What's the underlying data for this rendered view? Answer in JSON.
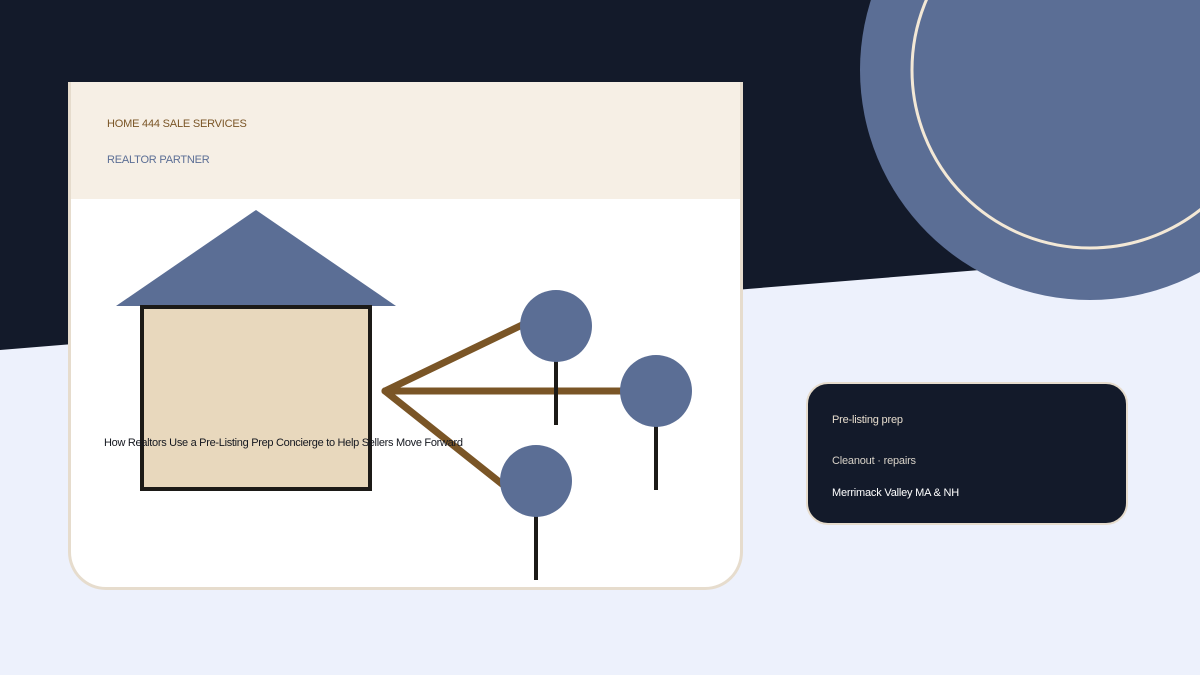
{
  "brand": {
    "eyebrow": "HOME 444 SALE SERVICES",
    "subtag": "REALTOR PARTNER"
  },
  "hero": {
    "headline": "How Realtors Use a Pre-Listing Prep Concierge to Help Sellers Move Forward"
  },
  "info_card": {
    "line1": "Pre-listing prep",
    "line2": "Cleanout · repairs",
    "line3": "Merrimack Valley MA & NH"
  },
  "illustration": {
    "house_icon": "house-icon",
    "tree_icon": "tree-icon",
    "branch_icon": "branch-line-icon"
  },
  "colors": {
    "navy": "#131a2a",
    "slate_blue": "#5b6e95",
    "cream": "#f6efe5",
    "tan": "#e8d8bd",
    "brown": "#7a5526",
    "pale_blue": "#edf1fc",
    "beige_border": "#e6dccd"
  }
}
